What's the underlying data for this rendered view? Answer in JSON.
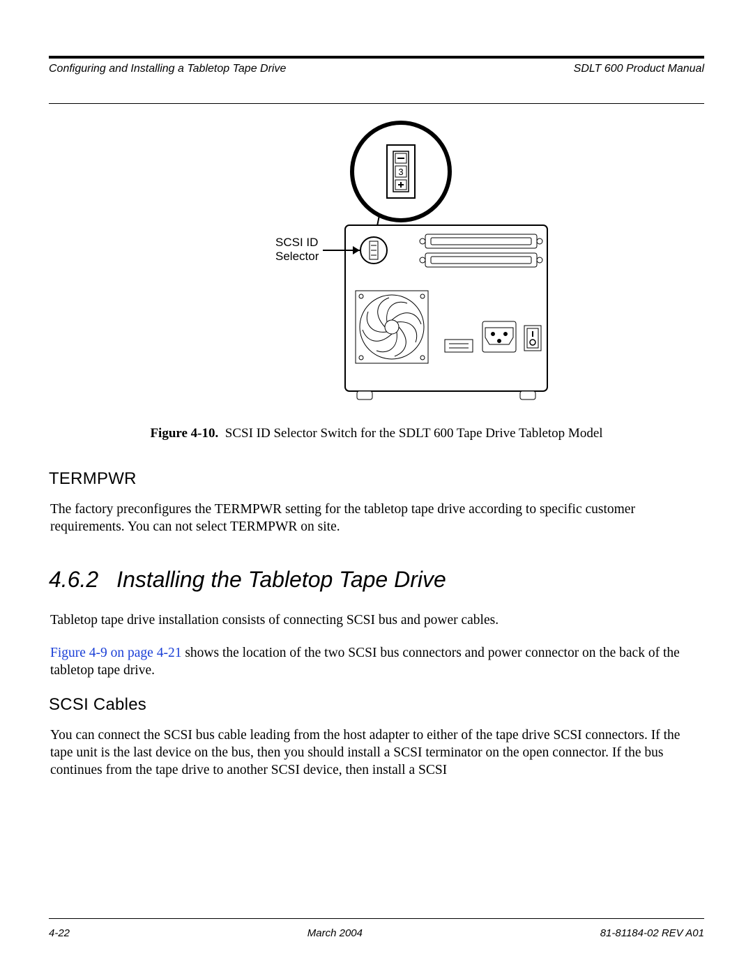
{
  "header": {
    "left": "Configuring and Installing a Tabletop Tape Drive",
    "right": "SDLT 600 Product Manual"
  },
  "figure": {
    "label_line1": "SCSI ID",
    "label_line2": "Selector",
    "switch_digit": "3",
    "caption_prefix": "Figure 4-10.",
    "caption_text": "SCSI ID Selector Switch for the SDLT 600 Tape Drive Tabletop Model"
  },
  "sections": {
    "termpwr": {
      "title": "TERMPWR",
      "body": "The factory preconfigures the TERMPWR setting for the tabletop tape drive according to specific customer requirements. You can not select TERMPWR on site."
    },
    "install": {
      "number": "4.6.2",
      "title": "Installing the Tabletop Tape Drive",
      "intro": "Tabletop tape drive installation consists of connecting SCSI bus and power cables.",
      "xref": "Figure 4-9 on page 4-21",
      "xref_tail": " shows the location of the two SCSI bus connectors and power connector on the back of the tabletop tape drive."
    },
    "scsi": {
      "title": "SCSI Cables",
      "body": "You can connect the SCSI bus cable leading from the host adapter to either of the tape drive SCSI connectors. If the tape unit is the last device on the bus, then you should install a SCSI terminator on the open connector. If the bus continues from the tape drive to another SCSI device, then install a SCSI"
    }
  },
  "footer": {
    "left": "4-22",
    "center": "March 2004",
    "right": "81-81184-02 REV A01"
  }
}
